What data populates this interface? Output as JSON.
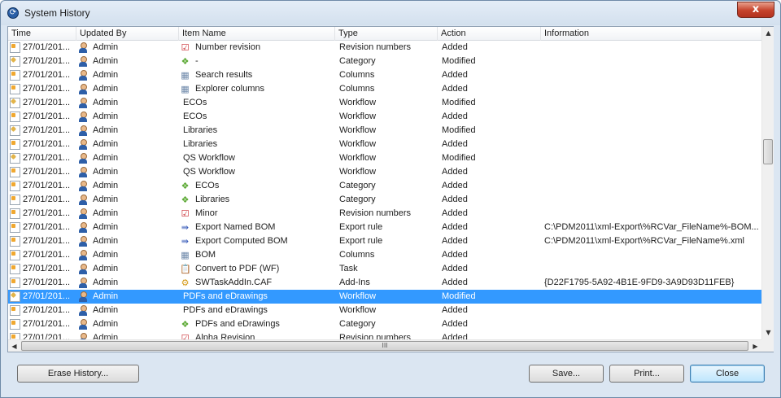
{
  "window": {
    "title": "System History",
    "close_glyph": "x"
  },
  "columns": [
    "Time",
    "Updated By",
    "Item Name",
    "Type",
    "Action",
    "Information"
  ],
  "rows": [
    {
      "time": "27/01/201...",
      "user": "Admin",
      "icon": "revision-icon",
      "item": "Number revision",
      "type": "Revision numbers",
      "action": "Added",
      "info": "",
      "edit": false
    },
    {
      "time": "27/01/201...",
      "user": "Admin",
      "icon": "category-icon",
      "item": "-",
      "type": "Category",
      "action": "Modified",
      "info": "",
      "edit": true
    },
    {
      "time": "27/01/201...",
      "user": "Admin",
      "icon": "columns-icon",
      "item": "Search results",
      "type": "Columns",
      "action": "Added",
      "info": "",
      "edit": false
    },
    {
      "time": "27/01/201...",
      "user": "Admin",
      "icon": "columns-icon",
      "item": "Explorer columns",
      "type": "Columns",
      "action": "Added",
      "info": "",
      "edit": false
    },
    {
      "time": "27/01/201...",
      "user": "Admin",
      "icon": "",
      "item": "ECOs",
      "type": "Workflow",
      "action": "Modified",
      "info": "",
      "edit": true
    },
    {
      "time": "27/01/201...",
      "user": "Admin",
      "icon": "",
      "item": "ECOs",
      "type": "Workflow",
      "action": "Added",
      "info": "",
      "edit": false
    },
    {
      "time": "27/01/201...",
      "user": "Admin",
      "icon": "",
      "item": "Libraries",
      "type": "Workflow",
      "action": "Modified",
      "info": "",
      "edit": true
    },
    {
      "time": "27/01/201...",
      "user": "Admin",
      "icon": "",
      "item": "Libraries",
      "type": "Workflow",
      "action": "Added",
      "info": "",
      "edit": false
    },
    {
      "time": "27/01/201...",
      "user": "Admin",
      "icon": "",
      "item": "QS Workflow",
      "type": "Workflow",
      "action": "Modified",
      "info": "",
      "edit": true
    },
    {
      "time": "27/01/201...",
      "user": "Admin",
      "icon": "",
      "item": "QS Workflow",
      "type": "Workflow",
      "action": "Added",
      "info": "",
      "edit": false
    },
    {
      "time": "27/01/201...",
      "user": "Admin",
      "icon": "category-icon",
      "item": "ECOs",
      "type": "Category",
      "action": "Added",
      "info": "",
      "edit": false
    },
    {
      "time": "27/01/201...",
      "user": "Admin",
      "icon": "category-icon",
      "item": "Libraries",
      "type": "Category",
      "action": "Added",
      "info": "",
      "edit": false
    },
    {
      "time": "27/01/201...",
      "user": "Admin",
      "icon": "revision-icon",
      "item": "Minor",
      "type": "Revision numbers",
      "action": "Added",
      "info": "",
      "edit": false
    },
    {
      "time": "27/01/201...",
      "user": "Admin",
      "icon": "export-icon",
      "item": "Export Named BOM",
      "type": "Export rule",
      "action": "Added",
      "info": "C:\\PDM2011\\xml-Export\\%RCVar_FileName%-BOM...",
      "edit": false
    },
    {
      "time": "27/01/201...",
      "user": "Admin",
      "icon": "export-icon",
      "item": "Export Computed BOM",
      "type": "Export rule",
      "action": "Added",
      "info": "C:\\PDM2011\\xml-Export\\%RCVar_FileName%.xml",
      "edit": false
    },
    {
      "time": "27/01/201...",
      "user": "Admin",
      "icon": "columns-icon",
      "item": "BOM",
      "type": "Columns",
      "action": "Added",
      "info": "",
      "edit": false
    },
    {
      "time": "27/01/201...",
      "user": "Admin",
      "icon": "task-icon",
      "item": "Convert to PDF (WF)",
      "type": "Task",
      "action": "Added",
      "info": "",
      "edit": false
    },
    {
      "time": "27/01/201...",
      "user": "Admin",
      "icon": "addin-icon",
      "item": "SWTaskAddIn.CAF",
      "type": "Add-Ins",
      "action": "Added",
      "info": "{D22F1795-5A92-4B1E-9FD9-3A9D93D11FEB}",
      "edit": false
    },
    {
      "time": "27/01/201...",
      "user": "Admin",
      "icon": "",
      "item": "PDFs and eDrawings",
      "type": "Workflow",
      "action": "Modified",
      "info": "",
      "edit": true,
      "selected": true
    },
    {
      "time": "27/01/201...",
      "user": "Admin",
      "icon": "",
      "item": "PDFs and eDrawings",
      "type": "Workflow",
      "action": "Added",
      "info": "",
      "edit": false
    },
    {
      "time": "27/01/201...",
      "user": "Admin",
      "icon": "category-icon",
      "item": "PDFs and eDrawings",
      "type": "Category",
      "action": "Added",
      "info": "",
      "edit": false
    },
    {
      "time": "27/01/201...",
      "user": "Admin",
      "icon": "revision-icon",
      "item": "Alpha Revision",
      "type": "Revision numbers",
      "action": "Added",
      "info": "",
      "edit": false
    }
  ],
  "icon_glyphs": {
    "revision-icon": "☑",
    "category-icon": "❖",
    "columns-icon": "▦",
    "export-icon": "⇛",
    "task-icon": "📋",
    "addin-icon": "⚙"
  },
  "icon_colors": {
    "revision-icon": "#c8282e",
    "category-icon": "#5aa832",
    "columns-icon": "#6b86a8",
    "export-icon": "#3559b8",
    "task-icon": "#c89a2a",
    "addin-icon": "#d49a18"
  },
  "scroll": {
    "h_thumb_grip": "III"
  },
  "buttons": {
    "erase": "Erase History...",
    "save": "Save...",
    "print": "Print...",
    "close": "Close"
  },
  "colors": {
    "selection": "#3399ff"
  }
}
